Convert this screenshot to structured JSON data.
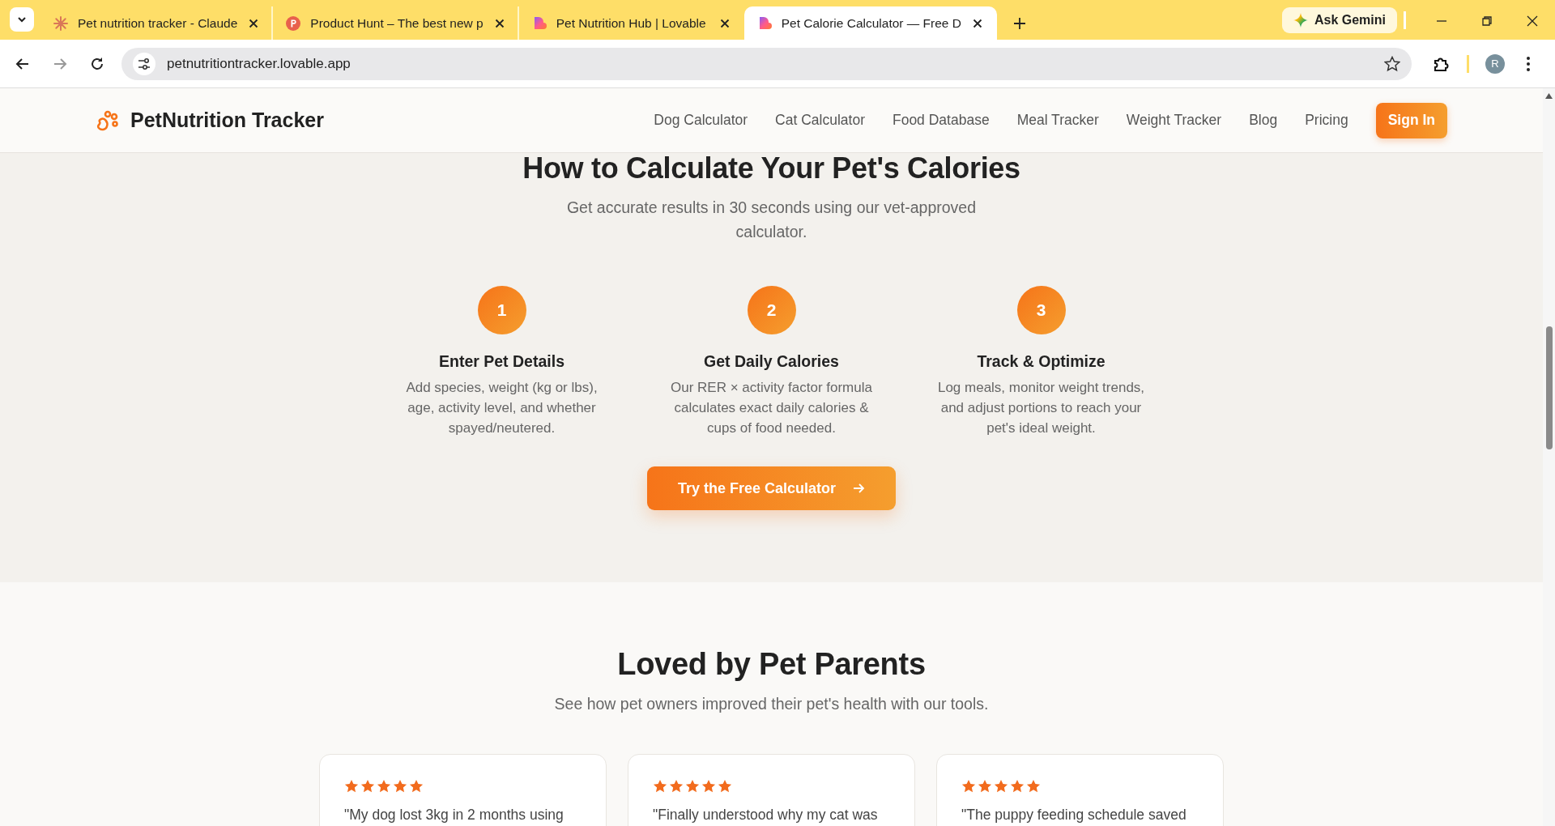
{
  "browser": {
    "tabs": [
      {
        "title": "Pet nutrition tracker - Claude",
        "kind": "burst",
        "selected": false
      },
      {
        "title": "Product Hunt – The best new p",
        "kind": "disc",
        "selected": false
      },
      {
        "title": "Pet Nutrition Hub | Lovable",
        "kind": "heart",
        "selected": false
      },
      {
        "title": "Pet Calorie Calculator — Free D",
        "kind": "heart",
        "selected": true
      }
    ],
    "ask_gemini": "Ask Gemini",
    "address": "petnutritiontracker.lovable.app",
    "profile_initial": "R"
  },
  "header": {
    "logo": "PetNutrition Tracker",
    "nav": [
      "Dog Calculator",
      "Cat Calculator",
      "Food Database",
      "Meal Tracker",
      "Weight Tracker",
      "Blog",
      "Pricing"
    ],
    "sign_in": "Sign In"
  },
  "how_to": {
    "title": "How to Calculate Your Pet's Calories",
    "subtitle": "Get accurate results in 30 seconds using our vet-approved calculator.",
    "steps": [
      {
        "number": "1",
        "title": "Enter Pet Details",
        "text": "Add species, weight (kg or lbs), age, activity level, and whether spayed/neutered."
      },
      {
        "number": "2",
        "title": "Get Daily Calories",
        "text": "Our RER × activity factor formula calculates exact daily calories & cups of food needed."
      },
      {
        "number": "3",
        "title": "Track & Optimize",
        "text": "Log meals, monitor weight trends, and adjust portions to reach your pet's ideal weight."
      }
    ],
    "cta": "Try the Free Calculator"
  },
  "reviews": {
    "title": "Loved by Pet Parents",
    "subtitle": "See how pet owners improved their pet's health with our tools.",
    "cards": [
      {
        "stars": 5,
        "quote": "\"My dog lost 3kg in 2 months using"
      },
      {
        "stars": 5,
        "quote": "\"Finally understood why my cat was"
      },
      {
        "stars": 5,
        "quote": "\"The puppy feeding schedule saved"
      }
    ]
  }
}
